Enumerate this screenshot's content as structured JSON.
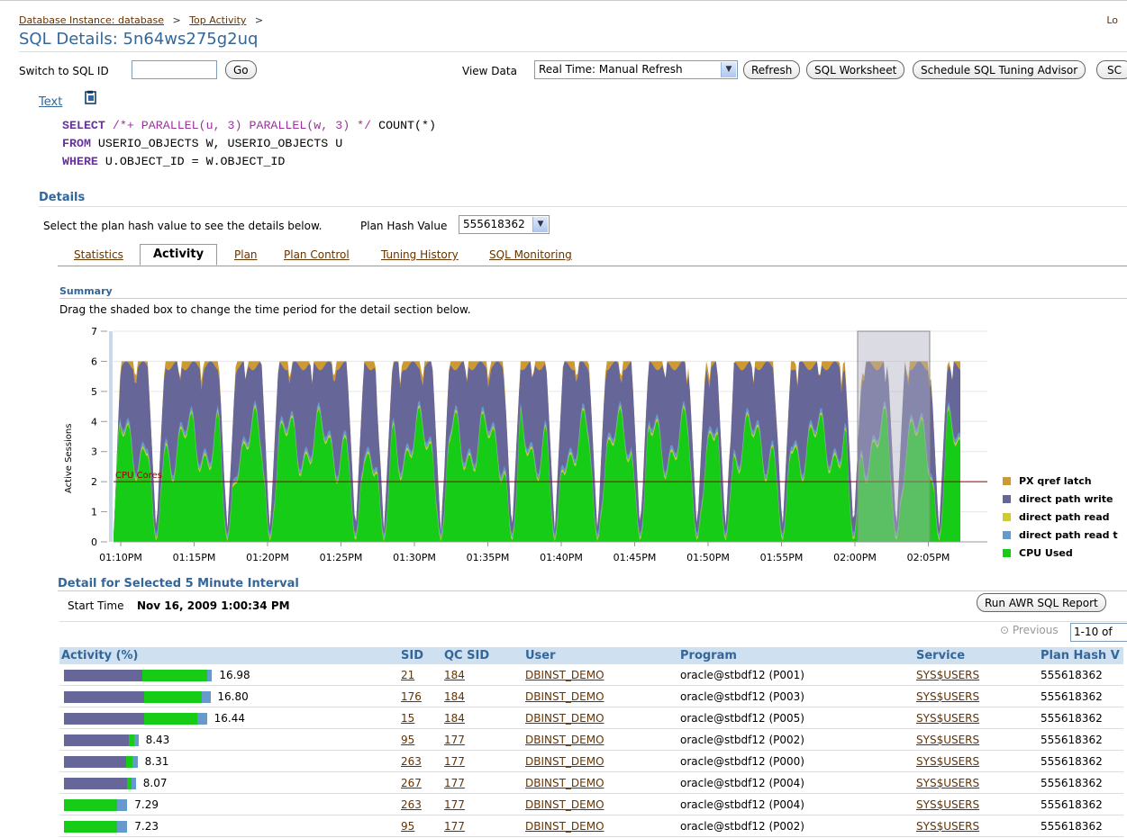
{
  "header": {
    "breadcrumb": [
      {
        "label": "Database Instance: database"
      },
      {
        "label": "Top Activity"
      }
    ],
    "breadcrumb_sep": ">",
    "top_right": "Lo",
    "title": "SQL Details: 5n64ws275g2uq"
  },
  "toolbar": {
    "switch_label": "Switch to SQL ID",
    "switch_value": "",
    "go_label": "Go",
    "view_data_label": "View Data",
    "view_data_value": "Real Time: Manual Refresh",
    "refresh_label": "Refresh",
    "worksheet_label": "SQL Worksheet",
    "tuning_label": "Schedule SQL Tuning Advisor",
    "extra_label": "SC"
  },
  "text_section": {
    "heading": "Text",
    "icon": "copy-document-icon",
    "sql_lines": [
      {
        "kw": "SELECT",
        "hint": "/*+ PARALLEL(u, 3) PARALLEL(w, 3) */",
        "rest": "COUNT(*)"
      },
      {
        "kw": "FROM",
        "rest": "USERIO_OBJECTS W, USERIO_OBJECTS U"
      },
      {
        "kw": "WHERE",
        "rest": "U.OBJECT_ID = W.OBJECT_ID"
      }
    ]
  },
  "details": {
    "heading": "Details",
    "instruction": "Select the plan hash value to see the details below.",
    "plan_hash_label": "Plan Hash Value",
    "plan_hash_value": "555618362"
  },
  "tabs": [
    {
      "label": "Statistics",
      "active": false
    },
    {
      "label": "Activity",
      "active": true
    },
    {
      "label": "Plan",
      "active": false
    },
    {
      "label": "Plan Control",
      "active": false
    },
    {
      "label": "Tuning History",
      "active": false
    },
    {
      "label": "SQL Monitoring",
      "active": false
    }
  ],
  "summary": {
    "heading": "Summary",
    "instruction": "Drag the shaded box to change the time period for the detail section below."
  },
  "colors": {
    "cpu": "#17cc17",
    "direct_read_temp": "#6699cc",
    "direct_read": "#cccc33",
    "direct_write": "#666699",
    "px_latch": "#cc9933",
    "cores_line": "#990000",
    "link": "#663300",
    "header_blue": "#336699"
  },
  "chart_data": {
    "type": "area",
    "ylabel": "Active Sessions",
    "ylim": [
      0,
      7
    ],
    "yticks": [
      "0",
      "1",
      "2",
      "3",
      "4",
      "5",
      "6",
      "7"
    ],
    "x_ticks": [
      "01:10PM",
      "01:15PM",
      "01:20PM",
      "01:25PM",
      "01:30PM",
      "01:35PM",
      "01:40PM",
      "01:45PM",
      "01:50PM",
      "01:55PM",
      "02:00PM",
      "02:05PM"
    ],
    "reference_line": {
      "label": "CPU Cores",
      "value": 2
    },
    "selection_window": {
      "from_minute": 60.5,
      "to_minute": 65.5
    },
    "legend": [
      {
        "label": "PX qref latch",
        "color": "#cc9933"
      },
      {
        "label": "direct path write",
        "color": "#666699"
      },
      {
        "label": "direct path read",
        "color": "#cccc33"
      },
      {
        "label": "direct path read t",
        "color": "#6699cc"
      },
      {
        "label": "CPU Used",
        "color": "#17cc17"
      }
    ],
    "series": [
      {
        "name": "CPU Used",
        "total_level": 6,
        "typical_cpu": 3.2
      },
      {
        "name": "direct path write"
      },
      {
        "name": "direct path read"
      },
      {
        "name": "direct path read t"
      },
      {
        "name": "PX qref latch"
      }
    ],
    "x_range_minutes": [
      0,
      59.5
    ],
    "x_start_label": "01:10PM"
  },
  "detail": {
    "heading": "Detail for Selected 5 Minute Interval",
    "start_label": "Start Time",
    "start_value": "Nov 16, 2009 1:00:34 PM",
    "report_button": "Run AWR SQL Report",
    "previous_label": "Previous",
    "range_value": "1-10 of"
  },
  "table": {
    "columns": [
      "Activity (%)",
      "SID",
      "QC SID",
      "User",
      "Program",
      "Service",
      "Plan Hash V"
    ],
    "rows": [
      {
        "activity": "16.98",
        "write": 9.2,
        "cpu": 7.5,
        "temp": 0.3,
        "sid": "21",
        "qcsid": "184",
        "user": "DBINST_DEMO",
        "program": "oracle@stbdf12 (P001)",
        "service": "SYS$USERS",
        "plan": "555618362"
      },
      {
        "activity": "16.80",
        "write": 9.4,
        "cpu": 6.7,
        "temp": 0.7,
        "sid": "176",
        "qcsid": "184",
        "user": "DBINST_DEMO",
        "program": "oracle@stbdf12 (P003)",
        "service": "SYS$USERS",
        "plan": "555618362"
      },
      {
        "activity": "16.44",
        "write": 9.4,
        "cpu": 6.2,
        "temp": 0.8,
        "sid": "15",
        "qcsid": "184",
        "user": "DBINST_DEMO",
        "program": "oracle@stbdf12 (P005)",
        "service": "SYS$USERS",
        "plan": "555618362"
      },
      {
        "activity": "8.43",
        "write": 7.6,
        "cpu": 0.6,
        "temp": 0.2,
        "sid": "95",
        "qcsid": "177",
        "user": "DBINST_DEMO",
        "program": "oracle@stbdf12 (P002)",
        "service": "SYS$USERS",
        "plan": "555618362"
      },
      {
        "activity": "8.31",
        "write": 7.3,
        "cpu": 0.7,
        "temp": 0.3,
        "sid": "263",
        "qcsid": "177",
        "user": "DBINST_DEMO",
        "program": "oracle@stbdf12 (P000)",
        "service": "SYS$USERS",
        "plan": "555618362"
      },
      {
        "activity": "8.07",
        "write": 7.4,
        "cpu": 0.5,
        "temp": 0.2,
        "sid": "267",
        "qcsid": "177",
        "user": "DBINST_DEMO",
        "program": "oracle@stbdf12 (P004)",
        "service": "SYS$USERS",
        "plan": "555618362"
      },
      {
        "activity": "7.29",
        "write": 0,
        "cpu": 6.2,
        "temp": 0.9,
        "sid": "263",
        "qcsid": "177",
        "user": "DBINST_DEMO",
        "program": "oracle@stbdf12 (P004)",
        "service": "SYS$USERS",
        "plan": "555618362"
      },
      {
        "activity": "7.23",
        "write": 0,
        "cpu": 6.2,
        "temp": 0.9,
        "sid": "95",
        "qcsid": "177",
        "user": "DBINST_DEMO",
        "program": "oracle@stbdf12 (P002)",
        "service": "SYS$USERS",
        "plan": "555618362"
      }
    ]
  }
}
